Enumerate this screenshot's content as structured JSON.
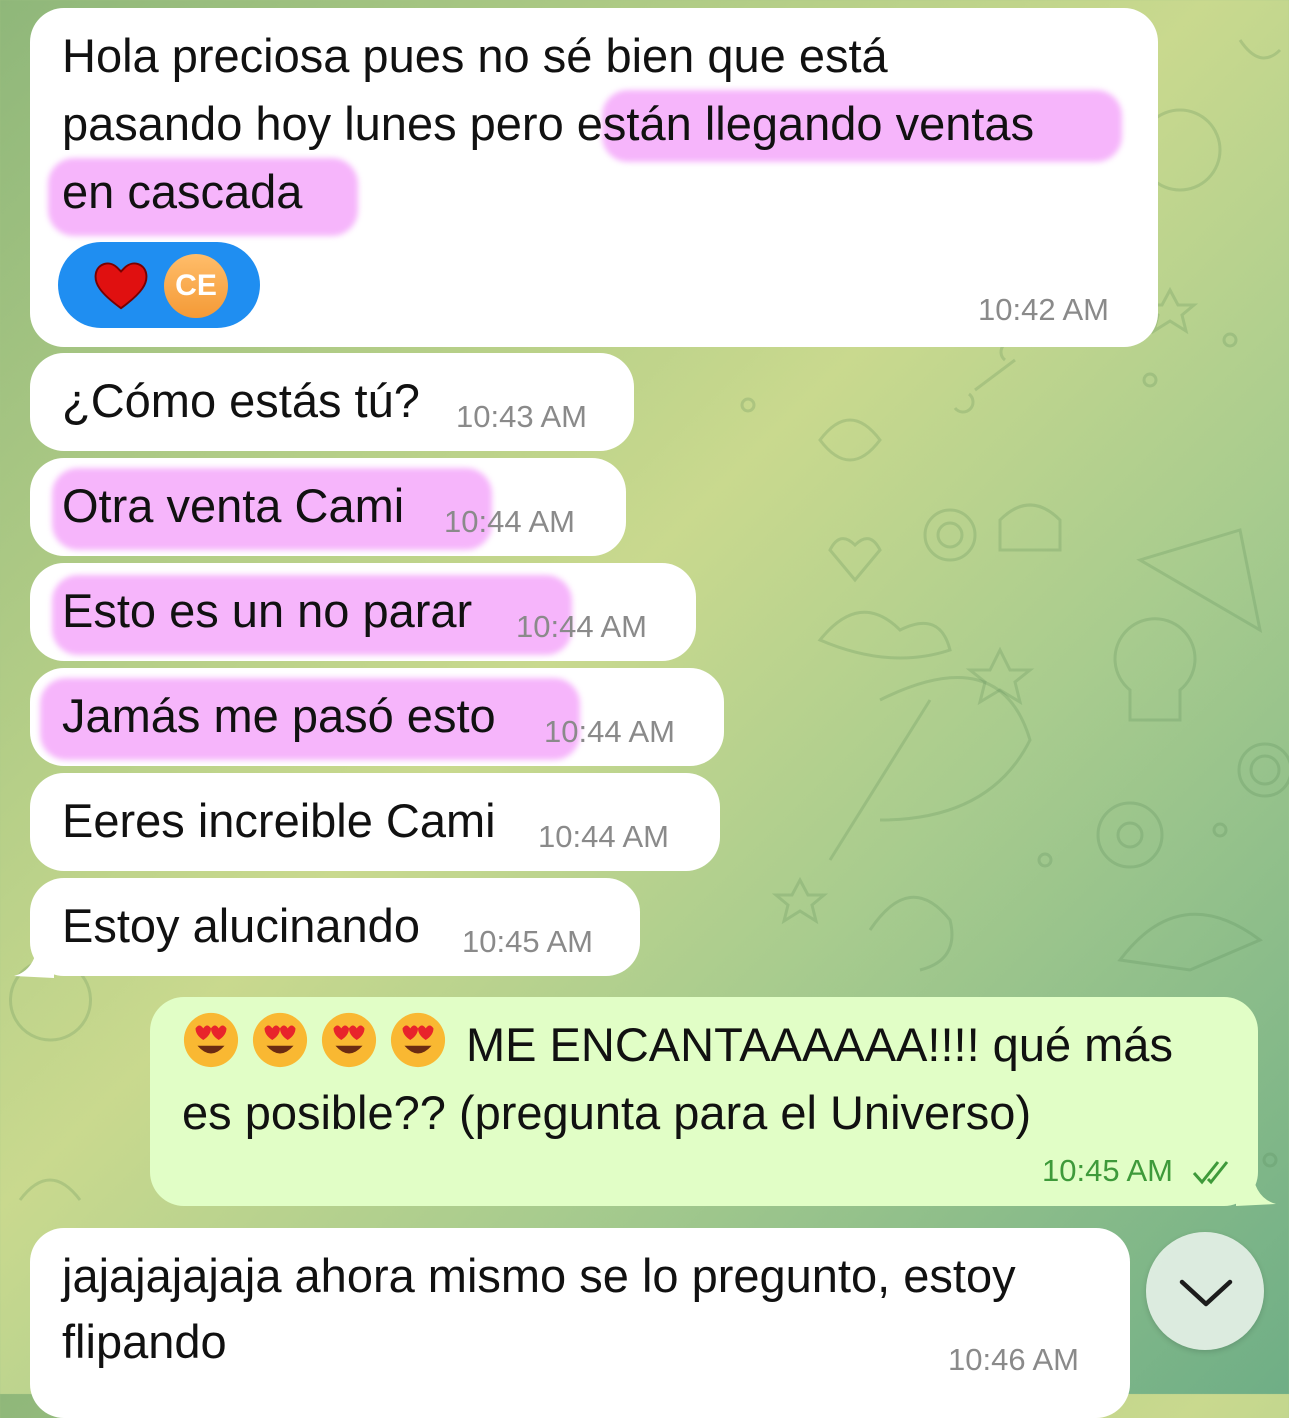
{
  "messages": [
    {
      "text_line1": "Hola preciosa pues no sé bien que está",
      "text_line2_plain": "pasando hoy lunes pero ",
      "text_line2_hl": "están llegando ventas",
      "text_line3_hl": "en cascada",
      "time": "10:42 AM",
      "reaction_avatar": "CE"
    },
    {
      "text": "¿Cómo estás tú?",
      "time": "10:43 AM"
    },
    {
      "text": "Otra venta Cami",
      "time": "10:44 AM"
    },
    {
      "text": "Esto es un no parar",
      "time": "10:44 AM"
    },
    {
      "text": "Jamás me pasó esto",
      "time": "10:44 AM"
    },
    {
      "text": "Eeres increible Cami",
      "time": "10:44 AM"
    },
    {
      "text": "Estoy alucinando",
      "time": "10:45 AM"
    },
    {
      "line1": "ME ENCANTAAAAAA!!!! qué más",
      "line2": "es posible?? (pregunta para el Universo)",
      "time": "10:45 AM"
    },
    {
      "line1": "jajajajajaja ahora mismo se lo pregunto, estoy",
      "line2": "flipando",
      "time": "10:46 AM"
    }
  ],
  "colors": {
    "incoming_bubble": "#ffffff",
    "outgoing_bubble": "#e1fec6",
    "highlight": "#f4a0fa",
    "reaction_pill": "#1f8ef1",
    "read_check": "#3e9a3a"
  },
  "icons": {
    "reaction": "heart-icon",
    "read_status": "double-check-icon",
    "scroll": "chevron-down-icon",
    "emoji": "heart-eyes-emoji"
  }
}
